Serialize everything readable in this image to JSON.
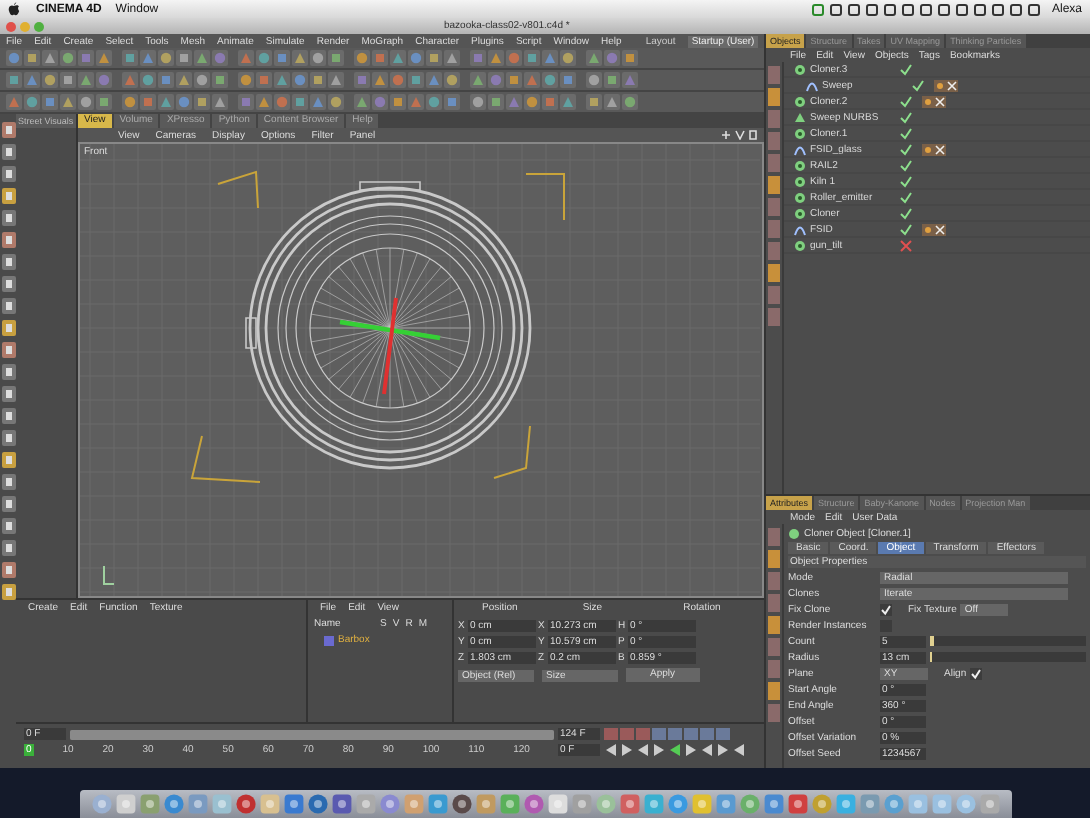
{
  "mac_menubar": {
    "app": "CINEMA 4D",
    "menus": [
      "Window"
    ],
    "user": "Alexa"
  },
  "window": {
    "title": "bazooka-class02-v801.c4d *"
  },
  "menu": [
    "File",
    "Edit",
    "Create",
    "Select",
    "Tools",
    "Mesh",
    "Animate",
    "Simulate",
    "Render",
    "MoGraph",
    "Character",
    "Plugins",
    "Script",
    "Window",
    "Help"
  ],
  "layout": {
    "label": "Layout",
    "value": "Startup (User)"
  },
  "side_panel": {
    "tab": "Street Visuals"
  },
  "viewport": {
    "tabs": [
      {
        "label": "View",
        "selected": true
      },
      {
        "label": "Volume",
        "selected": false
      },
      {
        "label": "XPresso",
        "selected": false
      },
      {
        "label": "Python",
        "selected": false
      },
      {
        "label": "Content Browser",
        "selected": false
      },
      {
        "label": "Help",
        "selected": false
      }
    ],
    "menu": [
      "View",
      "Cameras",
      "Display",
      "Options",
      "Filter",
      "Panel"
    ],
    "camera": "Front"
  },
  "object_manager": {
    "tabs": [
      {
        "label": "Objects",
        "selected": true
      },
      {
        "label": "Structure",
        "selected": false
      },
      {
        "label": "Takes",
        "selected": false
      },
      {
        "label": "UV Mapping",
        "selected": false
      },
      {
        "label": "Thinking Particles",
        "selected": false
      }
    ],
    "menu": [
      "File",
      "Edit",
      "View",
      "Objects",
      "Tags",
      "Bookmarks"
    ],
    "objects": [
      {
        "name": "Cloner.3",
        "kind": "cloner",
        "enabled": true,
        "tagged": false,
        "children": [
          {
            "name": "Sweep",
            "kind": "spline",
            "enabled": true,
            "tagged": true
          }
        ]
      },
      {
        "name": "Cloner.2",
        "kind": "cloner",
        "enabled": true,
        "tagged": true
      },
      {
        "name": "Sweep NURBS",
        "kind": "sweep",
        "enabled": true,
        "tagged": false
      },
      {
        "name": "Cloner.1",
        "kind": "cloner",
        "enabled": true,
        "tagged": false
      },
      {
        "name": "FSID_glass",
        "kind": "spline",
        "enabled": true,
        "tagged": true
      },
      {
        "name": "RAIL2",
        "kind": "cloner",
        "enabled": true,
        "tagged": false
      },
      {
        "name": "Kiln 1",
        "kind": "cloner",
        "enabled": true,
        "tagged": false
      },
      {
        "name": "Roller_emitter",
        "kind": "cloner",
        "enabled": true,
        "tagged": false
      },
      {
        "name": "Cloner",
        "kind": "cloner",
        "enabled": true,
        "tagged": false
      },
      {
        "name": "FSID",
        "kind": "spline",
        "enabled": true,
        "tagged": true
      },
      {
        "name": "gun_tilt",
        "kind": "cloner",
        "enabled": false,
        "tagged": false
      }
    ]
  },
  "attributes": {
    "tabs": [
      {
        "label": "Attributes",
        "selected": true
      },
      {
        "label": "Structure",
        "selected": false
      },
      {
        "label": "Baby-Kanone",
        "selected": false
      },
      {
        "label": "Nodes",
        "selected": false
      },
      {
        "label": "Projection Man",
        "selected": false
      }
    ],
    "menu": [
      "Mode",
      "Edit",
      "User Data"
    ],
    "object_title": "Cloner Object [Cloner.1]",
    "subtabs": [
      {
        "label": "Basic",
        "selected": false
      },
      {
        "label": "Coord.",
        "selected": false
      },
      {
        "label": "Object",
        "selected": true
      },
      {
        "label": "Transform",
        "selected": false
      },
      {
        "label": "Effectors",
        "selected": false
      }
    ],
    "section": "Object Properties",
    "rows": [
      [
        {
          "kind": "dropdown",
          "label": "Mode",
          "value": "Radial",
          "wide": true
        }
      ],
      [
        {
          "kind": "dropdown",
          "label": "Clones",
          "value": "Iterate",
          "wide": true
        }
      ],
      [
        {
          "kind": "check",
          "label": "Fix Clone",
          "checked": true
        },
        {
          "kind": "dropdown",
          "label": "Fix Texture",
          "value": "Off",
          "wide": false
        }
      ],
      [
        {
          "kind": "check",
          "label": "Render Instances",
          "checked": false
        }
      ],
      [
        {
          "kind": "slider",
          "label": "Count",
          "value": "5",
          "level": 0.02
        }
      ],
      [
        {
          "kind": "slider",
          "label": "Radius",
          "value": "13 cm",
          "level": 0.01
        }
      ],
      [
        {
          "kind": "dropdown",
          "label": "Plane",
          "value": "XY",
          "wide": false
        },
        {
          "kind": "check",
          "label": "Align",
          "checked": true
        }
      ],
      [
        {
          "kind": "number",
          "label": "Start Angle",
          "value": "0 °"
        }
      ],
      [
        {
          "kind": "number",
          "label": "End Angle",
          "value": "360 °"
        }
      ],
      [
        {
          "kind": "number",
          "label": "Offset",
          "value": "0 °"
        }
      ],
      [
        {
          "kind": "number",
          "label": "Offset Variation",
          "value": "0 %"
        }
      ],
      [
        {
          "kind": "number",
          "label": "Offset Seed",
          "value": "1234567"
        }
      ]
    ]
  },
  "materials": {
    "menu": [
      "Create",
      "Edit",
      "Function",
      "Texture"
    ]
  },
  "layers": {
    "menu": [
      "File",
      "Edit",
      "View"
    ],
    "header": "Name",
    "columns": [
      "S",
      "V",
      "R",
      "M"
    ],
    "rows": [
      "Barbox"
    ]
  },
  "coordinates": {
    "headers": [
      "Position",
      "Size",
      "Rotation"
    ],
    "rows": [
      {
        "pos_axis": "X",
        "pos": "0 cm",
        "size_axis": "X",
        "size": "10.273 cm",
        "rot_axis": "H",
        "rot": "0 °"
      },
      {
        "pos_axis": "Y",
        "pos": "0 cm",
        "size_axis": "Y",
        "size": "10.579 cm",
        "rot_axis": "P",
        "rot": "0 °"
      },
      {
        "pos_axis": "Z",
        "pos": "1.803 cm",
        "size_axis": "Z",
        "size": "0.2 cm",
        "rot_axis": "B",
        "rot": "0.859 °"
      }
    ],
    "mode": "Object (Rel)",
    "size_mode": "Size",
    "apply": "Apply"
  },
  "timeline": {
    "range": {
      "level": 1
    },
    "start": "0 F",
    "end": "124 F",
    "current": "0 F",
    "ticks": [
      "0",
      "10",
      "20",
      "30",
      "40",
      "50",
      "60",
      "70",
      "80",
      "90",
      "100",
      "110",
      "120"
    ]
  }
}
